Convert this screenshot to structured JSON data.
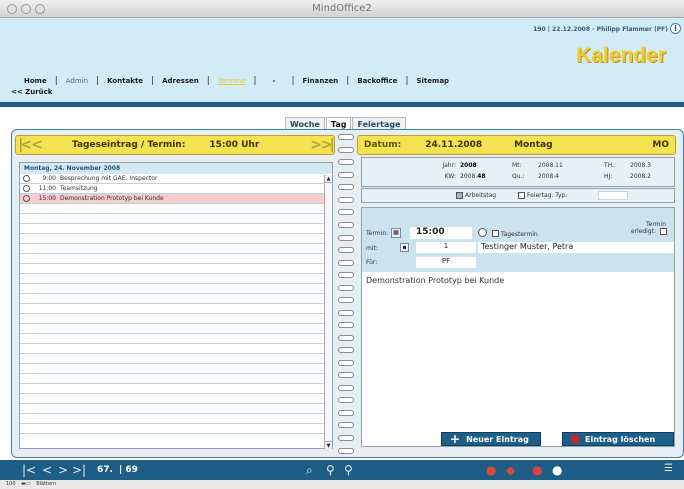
{
  "window": {
    "title": "MindOffice2"
  },
  "header": {
    "user_info": "190 | 22.12.2008 - Philipp Flammer (PF)",
    "page_title": "Kalender",
    "nav": [
      {
        "label": "Home",
        "style": "normal"
      },
      {
        "label": "Admin",
        "style": "dim"
      },
      {
        "label": "Kontakte",
        "style": "normal"
      },
      {
        "label": "Adressen",
        "style": "normal"
      },
      {
        "label": "Termine",
        "style": "active"
      },
      {
        "label": "-",
        "style": "normal"
      },
      {
        "label": "Finanzen",
        "style": "normal"
      },
      {
        "label": "Backoffice",
        "style": "normal"
      },
      {
        "label": "Sitemap",
        "style": "normal"
      }
    ],
    "back": "<< Zurück"
  },
  "tabs": [
    {
      "label": "Woche",
      "active": false
    },
    {
      "label": "Tag",
      "active": true
    },
    {
      "label": "Feiertage",
      "active": false
    }
  ],
  "left": {
    "title": "Tageseintrag / Termin:",
    "time": "15:00 Uhr",
    "date_header": "Montag, 24. November 2008",
    "entries": [
      {
        "time": "9:00",
        "text": "Besprechung mit GAE: Inspector",
        "highlight": false
      },
      {
        "time": "11:00",
        "text": "Teamsitzung",
        "highlight": false
      },
      {
        "time": "15:00",
        "text": "Demonstration Prototyp bei Kunde",
        "highlight": true
      }
    ]
  },
  "right": {
    "date_label": "Datum:",
    "date_value": "24.11.2008",
    "day": "Montag",
    "day_abbr": "MO",
    "info": {
      "jahr_label": "Jahr:",
      "jahr": "2008",
      "kw_label": "KW:",
      "kw_prefix": "2008.",
      "kw": "48",
      "mt_label": "Mt:",
      "mt": "2008.11",
      "qu_label": "Qu.:",
      "qu": "2008.4",
      "th_label": "TH.:",
      "th": "2008.3",
      "hj_label": "HJ:",
      "hj": "2008.2"
    },
    "arbeitstag": "Arbeitstag",
    "feiertag": "Feiertag. Typ:",
    "termin_label": "Termin:",
    "termin_time": "15:00",
    "tagestermin": "Tagestermin",
    "erledigt_1": "Termin",
    "erledigt_2": "erledigt:",
    "mit_label": "mit:",
    "mit_num": "1",
    "mit_name": "Testinger Muster, Petra",
    "fuer_label": "Für:",
    "fuer": "PF",
    "description": "Demonstration Prototyp bei Kunde",
    "new_button": "Neuer Eintrag",
    "delete_button": "Eintrag löschen"
  },
  "footer": {
    "record": "67.",
    "total": "| 69"
  },
  "status": {
    "zoom": "100",
    "mode": "Blättern"
  },
  "colors": {
    "accent": "#1d5d86",
    "yellow": "#f4e250",
    "title": "#f2cb2e",
    "highlight": "#f6cccc"
  }
}
